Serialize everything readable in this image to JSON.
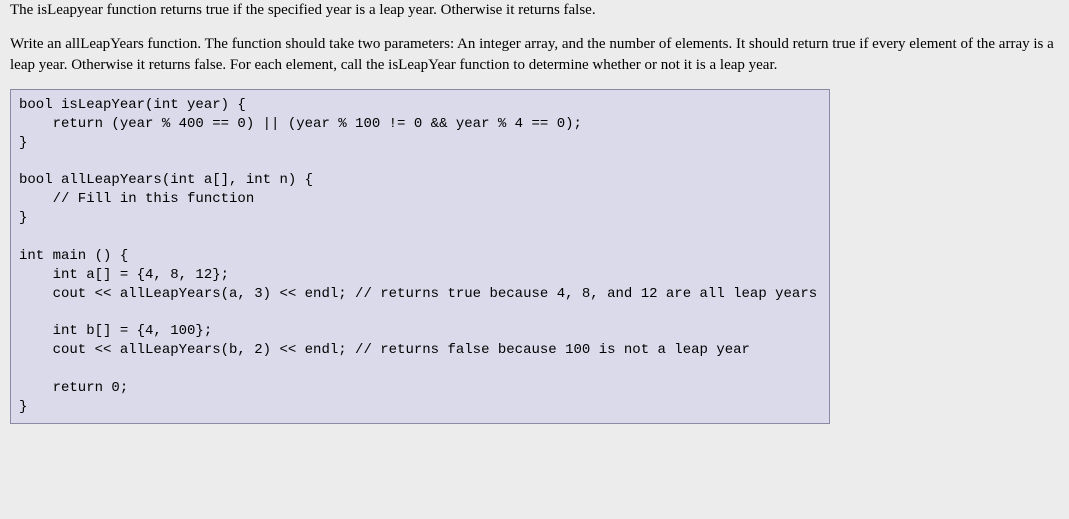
{
  "paragraphs": {
    "p1": "The isLeapyear function returns true if the specified year is a leap year. Otherwise it returns false.",
    "p2": "Write an allLeapYears function. The function should take two parameters: An integer array, and the number of elements. It should return true if every element of the array is a leap year. Otherwise it returns false. For each element, call the isLeapYear function to determine whether or not it is a leap year."
  },
  "code": "bool isLeapYear(int year) {\n    return (year % 400 == 0) || (year % 100 != 0 && year % 4 == 0);\n}\n\nbool allLeapYears(int a[], int n) {\n    // Fill in this function\n}\n\nint main () {\n    int a[] = {4, 8, 12};\n    cout << allLeapYears(a, 3) << endl; // returns true because 4, 8, and 12 are all leap years\n\n    int b[] = {4, 100};\n    cout << allLeapYears(b, 2) << endl; // returns false because 100 is not a leap year\n\n    return 0;\n}"
}
